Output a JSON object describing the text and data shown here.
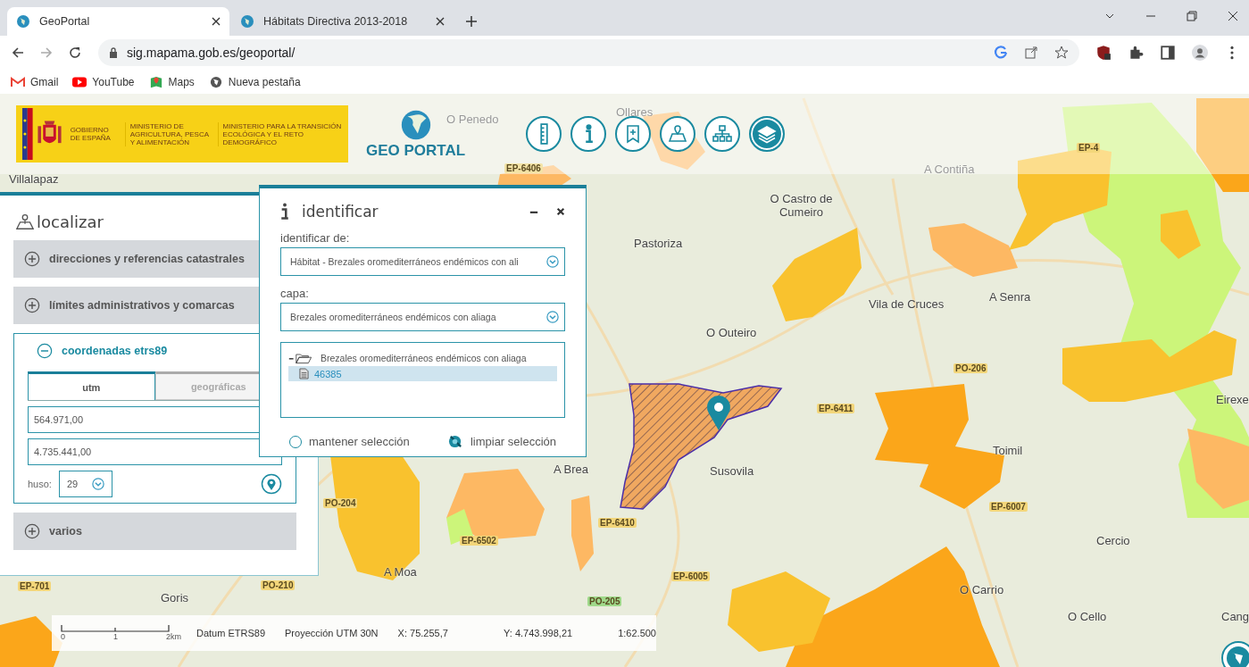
{
  "browser": {
    "tabs": [
      {
        "title": "GeoPortal",
        "selected": true
      },
      {
        "title": "Hábitats Directiva 2013-2018",
        "selected": false
      }
    ],
    "url": "sig.mapama.gob.es/geoportal/",
    "bookmarks": [
      {
        "label": "Gmail",
        "kind": "gmail"
      },
      {
        "label": "YouTube",
        "kind": "youtube"
      },
      {
        "label": "Maps",
        "kind": "maps"
      },
      {
        "label": "Nueva pestaña",
        "kind": "globe"
      }
    ]
  },
  "header": {
    "government": "GOBIERNO DE ESPAÑA",
    "ministry_1": "MINISTERIO DE AGRICULTURA, PESCA Y ALIMENTACIÓN",
    "ministry_2": "MINISTERIO PARA LA TRANSICIÓN ECOLÓGICA Y EL RETO DEMOGRÁFICO",
    "logo": "GEO PORTAL",
    "tools": [
      {
        "kind": "ruler",
        "selected": false
      },
      {
        "kind": "info",
        "selected": false
      },
      {
        "kind": "bookmark",
        "selected": false
      },
      {
        "kind": "map-pin",
        "selected": false
      },
      {
        "kind": "hierarchy",
        "selected": false
      },
      {
        "kind": "layers",
        "selected": true
      }
    ]
  },
  "localizar": {
    "title": "localizar",
    "sections": [
      {
        "label": "direcciones y referencias catastrales",
        "expanded": false
      },
      {
        "label": "límites administrativos y comarcas",
        "expanded": false
      },
      {
        "label": "coordenadas etrs89",
        "expanded": true
      },
      {
        "label": "varios",
        "expanded": false
      }
    ],
    "tabs": [
      {
        "label": "utm",
        "selected": true
      },
      {
        "label": "geográficas",
        "selected": false
      }
    ],
    "x_value": "564.971,00",
    "y_value": "4.735.441,00",
    "huso_label": "huso:",
    "huso_value": "29"
  },
  "identificar": {
    "title": "identificar",
    "source_label": "identificar de:",
    "source_value": "Hábitat - Brezales oromediterráneos endémicos con ali",
    "layer_label": "capa:",
    "layer_value": "Brezales oromediterráneos endémicos con aliaga",
    "tree": [
      {
        "label": "Brezales oromediterráneos endémicos con aliaga",
        "expanded": true,
        "children": [
          {
            "label": "46385",
            "selected": true
          }
        ]
      }
    ],
    "keep_selection": {
      "label": "mantener selección",
      "checked": false
    },
    "clear_selection": "limpiar selección"
  },
  "map": {
    "places": [
      "Villalapaz",
      "O Penedo",
      "Ollares",
      "A Contiña",
      "O Castro de Cumeiro",
      "Pastoriza",
      "Vila de Cruces",
      "A Senra",
      "O Outeiro",
      "Eirexe",
      "Toimil",
      "Susovila",
      "A Brea",
      "Cercio",
      "A Moa",
      "Goris",
      "O Carrio",
      "O Cello",
      "Cang"
    ],
    "roads": [
      {
        "label": "EP-6406",
        "color": "#f3e3a6"
      },
      {
        "label": "EP-4",
        "color": "#f3d67a"
      },
      {
        "label": "PO-206",
        "color": "#f3d67a"
      },
      {
        "label": "EP-6411",
        "color": "#f3d67a"
      },
      {
        "label": "EP-6410",
        "color": "#f3d67a"
      },
      {
        "label": "EP-6502",
        "color": "#f3d67a"
      },
      {
        "label": "EP-6005",
        "color": "#f3d67a"
      },
      {
        "label": "EP-6007",
        "color": "#f3d67a"
      },
      {
        "label": "PO-205",
        "color": "#9fd98a"
      },
      {
        "label": "PO-204",
        "color": "#f3d67a"
      },
      {
        "label": "PO-210",
        "color": "#f3d67a"
      },
      {
        "label": "EP-701",
        "color": "#f3d67a"
      }
    ]
  },
  "status": {
    "scale_ticks": [
      "0",
      "1",
      "2km"
    ],
    "datum": "Datum ETRS89",
    "projection": "Proyección UTM 30N",
    "x": "X: 75.255,7",
    "y": "Y: 4.743.998,21",
    "scale": "1:62.500"
  }
}
